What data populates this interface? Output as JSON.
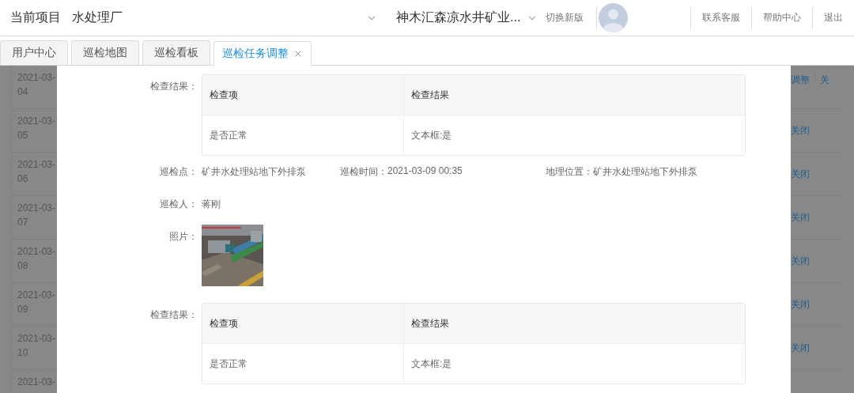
{
  "header": {
    "project_label": "当前项目",
    "project": "水处理厂",
    "company": "神木汇森凉水井矿业...",
    "switch_version": "切换新版",
    "links": [
      "联系客服",
      "帮助中心",
      "退出"
    ]
  },
  "tabs": [
    {
      "label": "用户中心",
      "selected": false,
      "closable": false
    },
    {
      "label": "巡检地图",
      "selected": false,
      "closable": false
    },
    {
      "label": "巡检看板",
      "selected": false,
      "closable": false
    },
    {
      "label": "巡检任务调整",
      "selected": true,
      "closable": true
    }
  ],
  "background_table": {
    "rows": [
      {
        "date": "2021-03-04",
        "actions": [
          "调整",
          "关"
        ]
      },
      {
        "date": "2021-03-05",
        "actions": [
          "关闭"
        ]
      },
      {
        "date": "2021-03-06",
        "actions": [
          "关闭"
        ]
      },
      {
        "date": "2021-03-07",
        "actions": [
          "关闭"
        ]
      },
      {
        "date": "2021-03-08",
        "actions": [
          "关闭"
        ]
      },
      {
        "date": "2021-03-09",
        "actions": [
          "关闭"
        ]
      },
      {
        "date": "2021-03-10",
        "actions": [
          "关闭"
        ]
      },
      {
        "date": "2021-03-"
      }
    ]
  },
  "dialog": {
    "sections": [
      {
        "kind": "results",
        "label": "检查结果：",
        "columns": [
          "检查项",
          "检查结果"
        ],
        "rows": [
          [
            "是否正常",
            "文本框:是"
          ]
        ]
      },
      {
        "kind": "fields",
        "fields": [
          {
            "label": "巡检点：",
            "value": "矿井水处理站地下外排泵"
          },
          {
            "label": "巡检时间：",
            "value": "2021-03-09 00:35"
          },
          {
            "label": "地理位置：",
            "value": "矿井水处理站地下外排泵"
          }
        ]
      },
      {
        "kind": "fields",
        "fields": [
          {
            "label": "巡检人：",
            "value": "蒋刚"
          }
        ]
      },
      {
        "label": "照片："
      },
      {
        "kind": "results",
        "label": "检查结果：",
        "columns": [
          "检查项",
          "检查结果"
        ],
        "rows": [
          [
            "是否正常",
            "文本框:是"
          ]
        ]
      }
    ]
  }
}
